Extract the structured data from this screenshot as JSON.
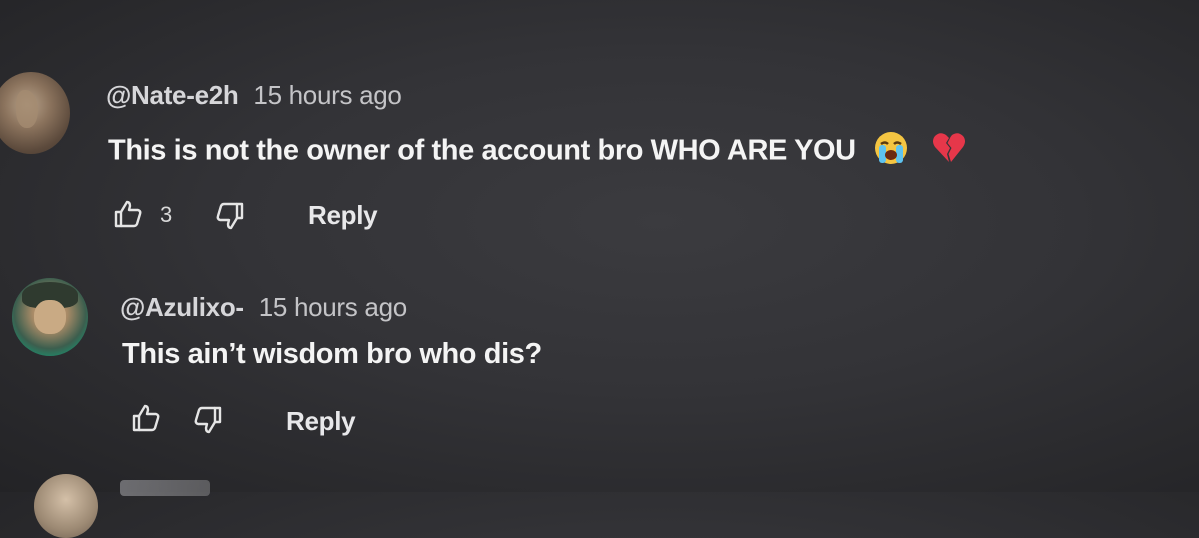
{
  "comments": [
    {
      "handle": "@Nate-e2h",
      "time": "15 hours ago",
      "text": "This is not the owner of the account bro WHO ARE YOU",
      "emojis": [
        "loudly-crying-face",
        "broken-heart"
      ],
      "likes": "3",
      "reply_label": "Reply"
    },
    {
      "handle": "@Azulixo-",
      "time": "15 hours ago",
      "text": "This ain’t wisdom bro who dis?",
      "likes": "",
      "reply_label": "Reply"
    }
  ],
  "colors": {
    "background": "#333337",
    "text": "#f4f4f4",
    "meta": "#c9c9cc"
  },
  "icons": [
    "thumbs-up-icon",
    "thumbs-down-icon",
    "loudly-crying-face-emoji",
    "broken-heart-emoji"
  ]
}
